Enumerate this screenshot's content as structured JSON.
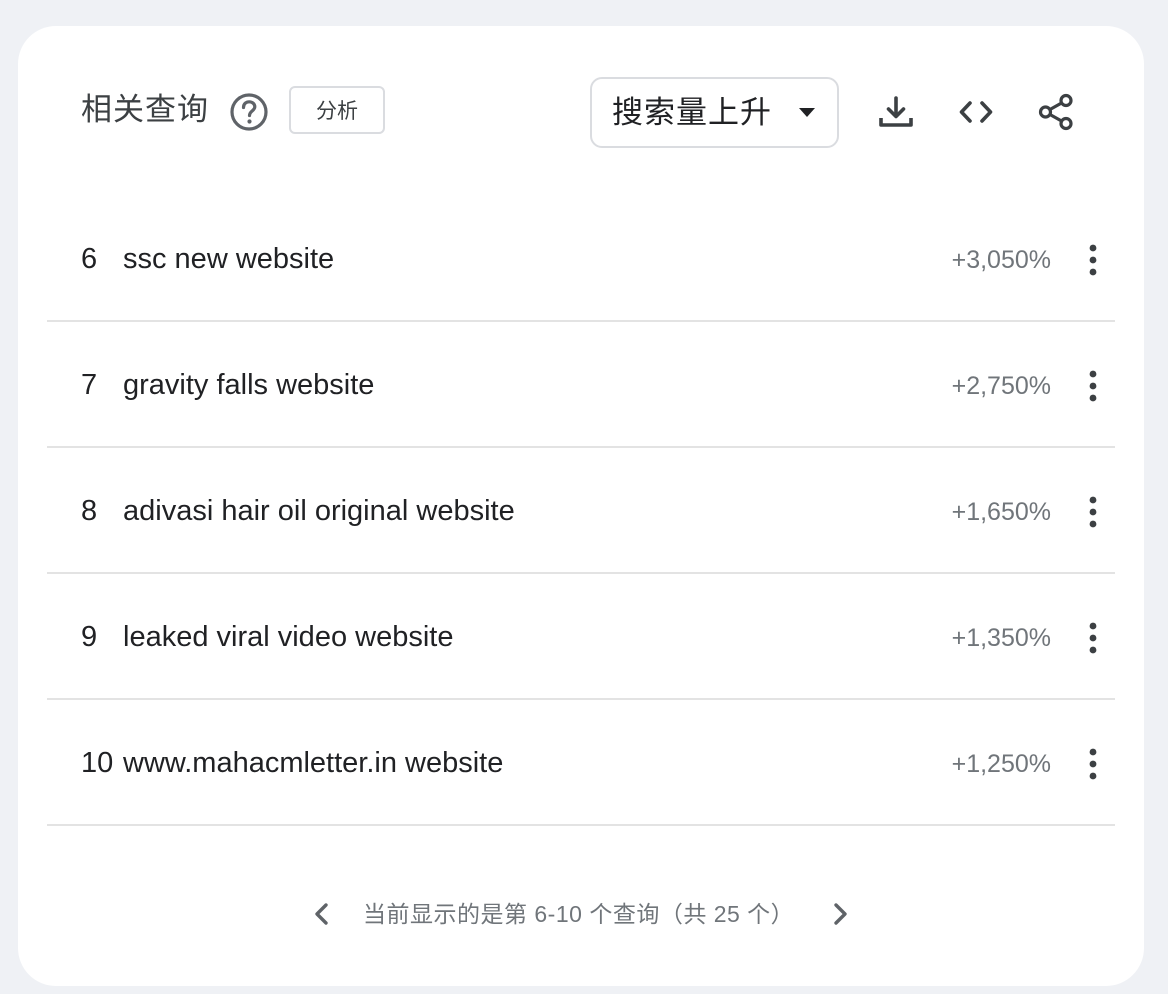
{
  "header": {
    "title": "相关查询",
    "help_icon": "help-circle-icon",
    "analyze_label": "分析",
    "sort_selected": "搜索量上升",
    "toolbar_icons": [
      "download-icon",
      "embed-code-icon",
      "share-icon"
    ]
  },
  "queries": [
    {
      "rank": "6",
      "query": "ssc new website",
      "value": "+3,050%"
    },
    {
      "rank": "7",
      "query": "gravity falls website",
      "value": "+2,750%"
    },
    {
      "rank": "8",
      "query": "adivasi hair oil original website",
      "value": "+1,650%"
    },
    {
      "rank": "9",
      "query": "leaked viral video website",
      "value": "+1,350%"
    },
    {
      "rank": "10",
      "query": "www.mahacmletter.in website",
      "value": "+1,250%"
    }
  ],
  "pagination": {
    "text": "当前显示的是第 6-10 个查询（共 25 个）"
  },
  "colors": {
    "background": "#eff1f5",
    "card": "#ffffff",
    "text": "#202124",
    "muted": "#70757a",
    "divider": "#e3e3e3"
  }
}
